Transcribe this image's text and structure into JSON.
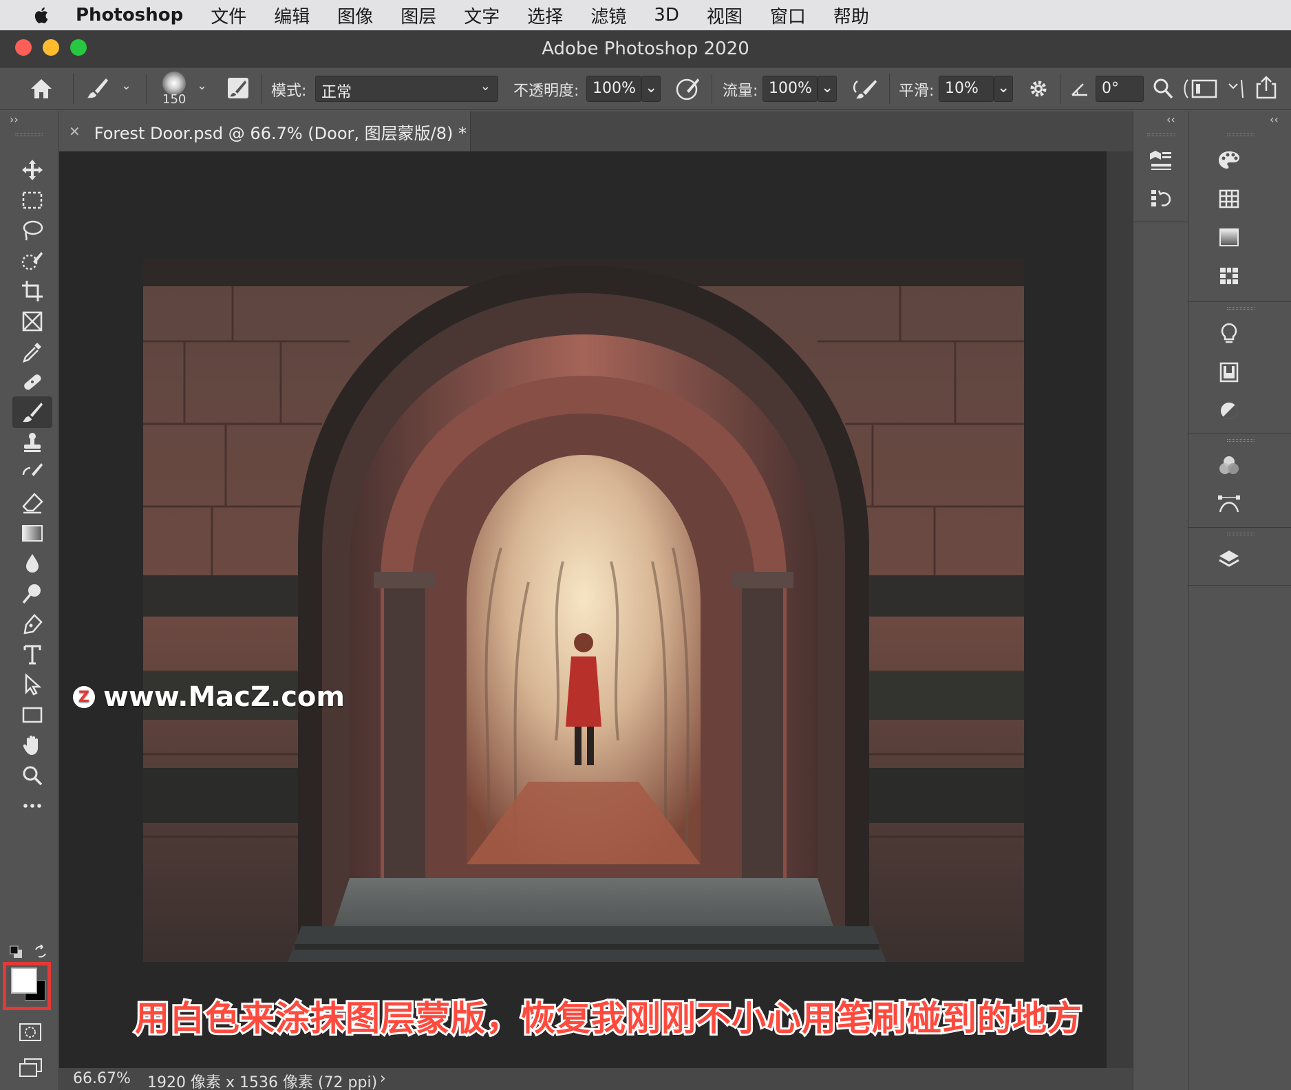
{
  "menubar": {
    "app_name": "Photoshop",
    "items": [
      "文件",
      "编辑",
      "图像",
      "图层",
      "文字",
      "选择",
      "滤镜",
      "3D",
      "视图",
      "窗口",
      "帮助"
    ]
  },
  "window": {
    "title": "Adobe Photoshop 2020",
    "traffic_colors": [
      "#fe5f57",
      "#febc2e",
      "#28c840"
    ]
  },
  "options": {
    "brush_size": "150",
    "mode_label": "模式:",
    "mode_value": "正常",
    "opacity_label": "不透明度:",
    "opacity_value": "100%",
    "flow_label": "流量:",
    "flow_value": "100%",
    "smoothing_label": "平滑:",
    "smoothing_value": "10%",
    "angle_value": "0°"
  },
  "tools": [
    "move-tool",
    "marquee-tool",
    "lasso-tool",
    "quick-selection-tool",
    "crop-tool",
    "frame-tool",
    "eyedropper-tool",
    "healing-brush-tool",
    "brush-tool",
    "clone-stamp-tool",
    "history-brush-tool",
    "eraser-tool",
    "gradient-tool",
    "blur-tool",
    "dodge-tool",
    "pen-tool",
    "type-tool",
    "path-selection-tool",
    "rectangle-tool",
    "hand-tool",
    "zoom-tool",
    "more-tools"
  ],
  "active_tool": "brush-tool",
  "document": {
    "tab_title": "Forest Door.psd @ 66.7% (Door, 图层蒙版/8) *"
  },
  "status": {
    "zoom": "66.67%",
    "doc_info": "1920 像素 x 1536 像素 (72 ppi)"
  },
  "overlay": {
    "watermark": "www.MacZ.com",
    "watermark_badge": "Z",
    "caption": "用白色来涂抹图层蒙版，恢复我刚刚不小心用笔刷碰到的地方"
  },
  "colors": {
    "foreground": "#ffffff",
    "background": "#000000",
    "highlight": "#e53935",
    "caption_fill": "#ff4a3e"
  },
  "right_panels": {
    "strip1": [
      "3d-panel-icon",
      "history-panel-icon"
    ],
    "strip2": [
      "color-panel-icon",
      "swatches-panel-icon",
      "gradients-panel-icon",
      "patterns-panel-icon",
      "learn-panel-icon",
      "libraries-panel-icon",
      "adjustments-panel-icon",
      "channels-panel-icon",
      "paths-panel-icon",
      "layers-panel-icon"
    ]
  }
}
